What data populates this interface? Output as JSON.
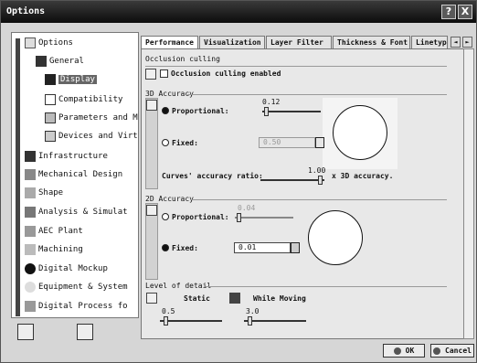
{
  "window": {
    "title": "Options",
    "help_label": "?",
    "close_label": "X"
  },
  "tree": {
    "root": "Options",
    "items": [
      {
        "label": "General"
      },
      {
        "label": "Display"
      },
      {
        "label": "Compatibility"
      },
      {
        "label": "Parameters and M"
      },
      {
        "label": "Devices and Virt"
      },
      {
        "label": "Infrastructure"
      },
      {
        "label": "Mechanical Design"
      },
      {
        "label": "Shape"
      },
      {
        "label": "Analysis & Simulat"
      },
      {
        "label": "AEC Plant"
      },
      {
        "label": "Machining"
      },
      {
        "label": "Digital Mockup"
      },
      {
        "label": "Equipment & System"
      },
      {
        "label": "Digital Process fo"
      }
    ]
  },
  "tabs": [
    "Performance",
    "Visualization",
    "Layer Filter",
    "Thickness & Font",
    "Linetyp"
  ],
  "tab_scroll": {
    "left": "◄",
    "right": "►"
  },
  "occlusion": {
    "title": "Occlusion culling",
    "checkbox_label": "Occlusion culling enabled",
    "checked": false
  },
  "accuracy3d": {
    "title": "3D Accuracy",
    "proportional_label": "Proportional:",
    "proportional_value": "0.12",
    "fixed_label": "Fixed:",
    "fixed_value": "0.50",
    "selected": "proportional",
    "curves_label": "Curves' accuracy ratio:",
    "curves_value": "1.00",
    "curves_suffix": "x 3D accuracy."
  },
  "accuracy2d": {
    "title": "2D Accuracy",
    "proportional_label": "Proportional:",
    "proportional_value": "0.04",
    "fixed_label": "Fixed:",
    "fixed_value": "0.01",
    "selected": "fixed"
  },
  "lod": {
    "title": "Level of detail",
    "static_label": "Static",
    "moving_label": "While Moving",
    "static_value": "0.5",
    "moving_value": "3.0"
  },
  "buttons": {
    "ok": "OK",
    "cancel": "Cancel"
  },
  "colors": {
    "titlebar": "#1a1a1a",
    "panel": "#e8e8e8"
  }
}
